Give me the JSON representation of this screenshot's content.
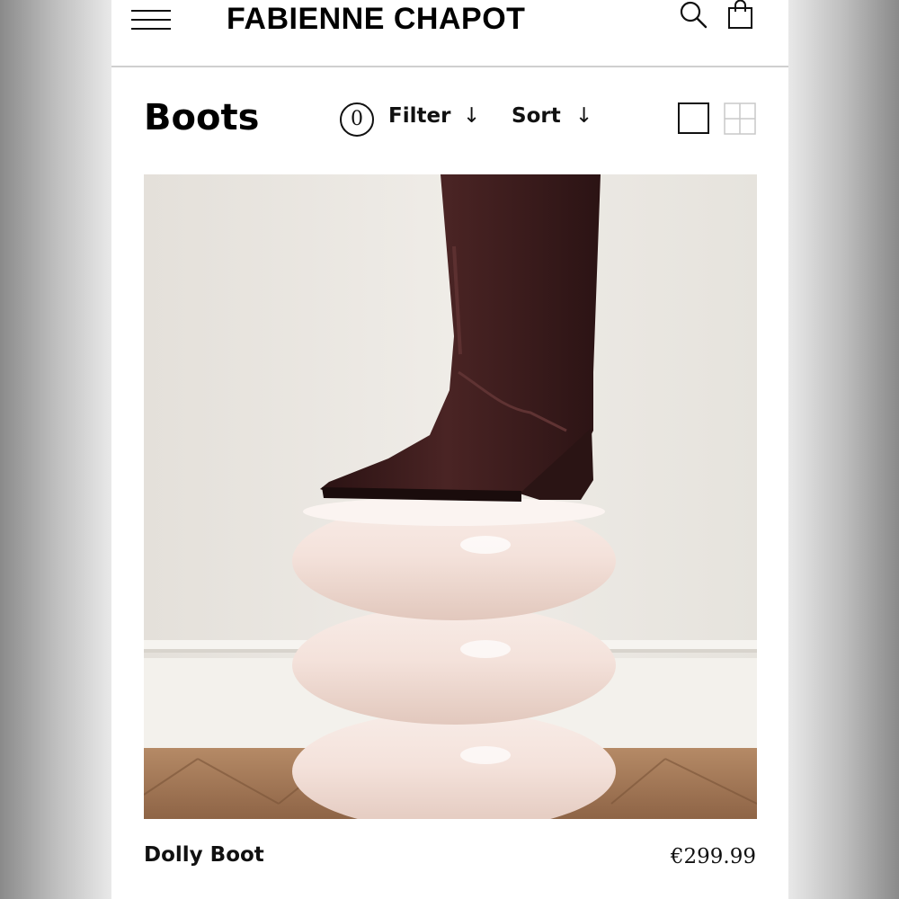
{
  "header": {
    "brand": "FABIENNE CHAPOT",
    "menu_icon": "hamburger-menu-icon",
    "search_icon": "search-icon",
    "bag_icon": "shopping-bag-icon"
  },
  "toolbar": {
    "title": "Boots",
    "filter_count": "0",
    "filter_label": "Filter",
    "filter_arrow": "↓",
    "sort_label": "Sort",
    "sort_arrow": "↓",
    "view_single_icon": "single-column-view-icon",
    "view_grid_icon": "grid-view-icon"
  },
  "product": {
    "name": "Dolly Boot",
    "price": "€299.99",
    "image_icon": "boot-product-photo"
  },
  "colors": {
    "text": "#111111",
    "divider": "#cfcfcf",
    "boot": "#3a1c1c",
    "stool": "#f1ddd6",
    "wall": "#eae7e1",
    "floor": "#a47a58"
  }
}
